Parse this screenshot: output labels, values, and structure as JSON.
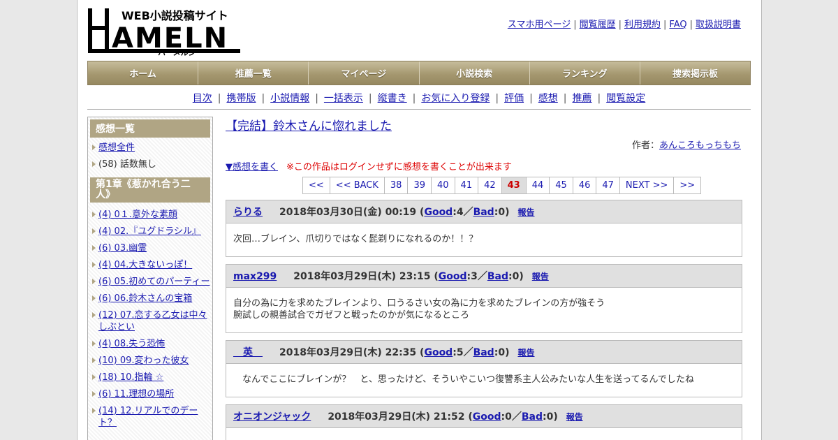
{
  "logo": {
    "tagline": "WEB小説投稿サイト",
    "name": "HAMELN",
    "kana": "ハーメルン"
  },
  "toplinks": [
    "スマホ用ページ",
    "閲覧履歴",
    "利用規約",
    "FAQ",
    "取扱説明書"
  ],
  "gnav": [
    "ホーム",
    "推薦一覧",
    "マイページ",
    "小説検索",
    "ランキング",
    "捜索掲示板"
  ],
  "subnav": [
    "目次",
    "携帯版",
    "小説情報",
    "一括表示",
    "縦書き",
    "お気に入り登録",
    "評価",
    "感想",
    "推薦",
    "閲覧設定"
  ],
  "sidebar": {
    "heading": "感想一覧",
    "top_items": [
      {
        "label": "感想全件",
        "link": true
      },
      {
        "label": "(58) 話数無し",
        "link": false
      }
    ],
    "chapter": "第1章《惹かれ合う二人》",
    "items": [
      "(4) 0１.意外な素顔",
      "(4) 02.『ユグドラシル』",
      "(6) 03.幽霊",
      "(4) 04.大きないっぽ！",
      "(6) 05.初めてのパーティー",
      "(6) 06.鈴木さんの宝箱",
      "(12) 07.恋する乙女は中々しぶとい",
      "(4) 08.失う恐怖",
      "(10) 09.変わった彼女",
      "(18) 10.指輪 ☆",
      "(6) 11.理想の場所",
      "(14) 12.リアルでのデート？"
    ]
  },
  "main": {
    "title": "【完結】鈴木さんに惚れました",
    "author_label": "作者：",
    "author": "あんころもっちもち",
    "write_link": "▼感想を書く",
    "warning": "※この作品はログインせずに感想を書くことが出来ます",
    "pager": {
      "first": "<<",
      "back": "<< BACK",
      "pages": [
        "38",
        "39",
        "40",
        "41",
        "42",
        "43",
        "44",
        "45",
        "46",
        "47"
      ],
      "current": "43",
      "next": "NEXT >>",
      "last": ">>"
    },
    "good_label": "Good",
    "bad_label": "Bad",
    "report_label": "報告",
    "reviews": [
      {
        "name": "らりる",
        "date": "2018年03月30日(金) 00:19",
        "good": "4",
        "bad": "0",
        "body": "次回…ブレイン、爪切りではなく髭剃りになれるのか！！？"
      },
      {
        "name": "max299",
        "date": "2018年03月29日(木) 23:15",
        "good": "3",
        "bad": "0",
        "body": "自分の為に力を求めたブレインより、口うるさい女の為に力を求めたブレインの方が強そう\n腕試しの親善試合でガゼフと戦ったのかが気になるところ"
      },
      {
        "name": "　英　",
        "date": "2018年03月29日(木) 22:35",
        "good": "5",
        "bad": "0",
        "body": "　なんでここにブレインが？　と、思ったけど、そういやこいつ復讐系主人公みたいな人生を送ってるんでしたね"
      },
      {
        "name": "オニオンジャック",
        "date": "2018年03月29日(木) 21:52",
        "good": "0",
        "bad": "0",
        "body": ""
      }
    ]
  }
}
